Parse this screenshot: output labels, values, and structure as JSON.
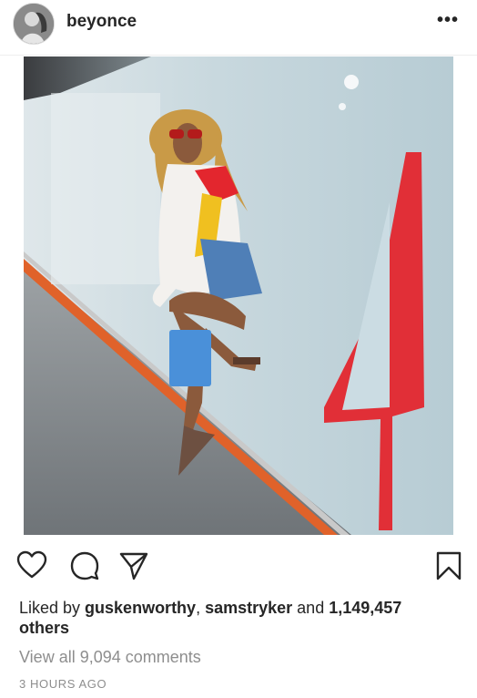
{
  "header": {
    "username": "beyonce",
    "more_icon": "more-horizontal-icon",
    "more_label": "•••"
  },
  "post": {
    "image_alt": "Woman in red sunglasses posing against a glass wall with a large red 4",
    "wall_number": "4"
  },
  "actions": {
    "like_icon": "heart-icon",
    "comment_icon": "comment-icon",
    "share_icon": "direct-share-icon",
    "save_icon": "bookmark-icon"
  },
  "likes": {
    "prefix": "Liked by ",
    "user1": "guskenworthy",
    "sep": ", ",
    "user2": "samstryker",
    "and": " and ",
    "count": "1,149,457",
    "suffix": "others"
  },
  "comments": {
    "view_all": "View all 9,094 comments"
  },
  "timestamp": "3 HOURS AGO",
  "colors": {
    "text": "#262626",
    "muted": "#8e8e8e",
    "accent_red": "#e3262e",
    "divider": "#efefef"
  }
}
